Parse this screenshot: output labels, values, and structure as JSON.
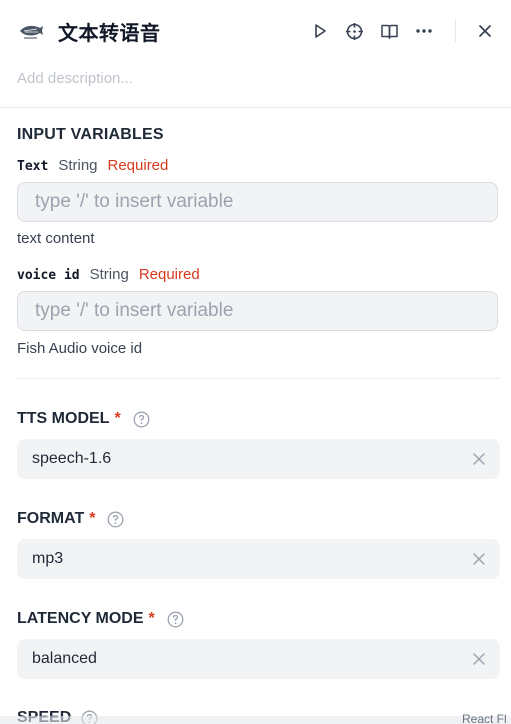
{
  "header": {
    "logo_icon": "fish-audio-logo",
    "title": "文本转语音",
    "actions": [
      "play-icon",
      "crosshair-icon",
      "book-open-icon",
      "more-horizontal-icon",
      "close-icon"
    ]
  },
  "description": {
    "placeholder": "Add description..."
  },
  "input_variables": {
    "title": "INPUT VARIABLES",
    "items": [
      {
        "name": "Text",
        "type": "String",
        "required": "Required",
        "placeholder": "type '/' to insert variable",
        "help": "text content"
      },
      {
        "name": "voice id",
        "type": "String",
        "required": "Required",
        "placeholder": "type '/' to insert variable",
        "help": "Fish Audio voice id"
      }
    ]
  },
  "fields": [
    {
      "label": "TTS MODEL",
      "required_mark": "*",
      "value": "speech-1.6"
    },
    {
      "label": "FORMAT",
      "required_mark": "*",
      "value": "mp3"
    },
    {
      "label": "LATENCY MODE",
      "required_mark": "*",
      "value": "balanced"
    },
    {
      "label": "SPEED"
    }
  ],
  "corner_text": "React Fl",
  "colors": {
    "required": "#d93a1f",
    "input_bg": "#f2f3f5",
    "border": "#e5e7eb"
  }
}
